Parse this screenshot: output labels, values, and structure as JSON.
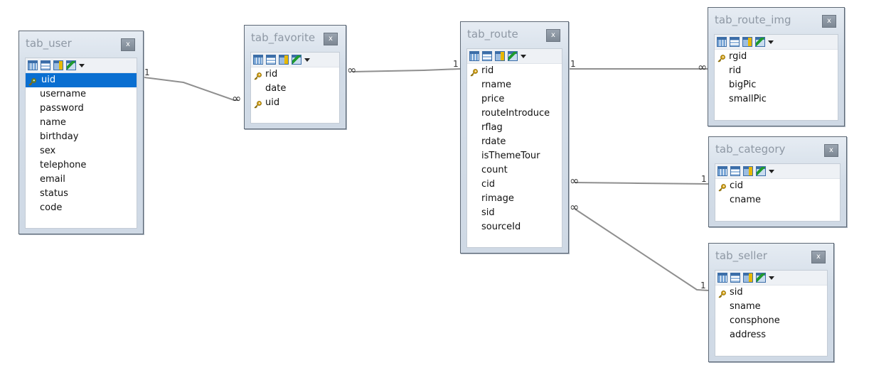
{
  "tables": {
    "tab_user": {
      "title": "tab_user",
      "close_label": "x",
      "fields": [
        {
          "name": "uid",
          "pk": true,
          "selected": true
        },
        {
          "name": "username"
        },
        {
          "name": "password"
        },
        {
          "name": "name"
        },
        {
          "name": "birthday"
        },
        {
          "name": "sex"
        },
        {
          "name": "telephone"
        },
        {
          "name": "email"
        },
        {
          "name": "status"
        },
        {
          "name": "code"
        }
      ]
    },
    "tab_favorite": {
      "title": "tab_favorite",
      "close_label": "x",
      "fields": [
        {
          "name": "rid",
          "pk": true
        },
        {
          "name": "date"
        },
        {
          "name": "uid",
          "pk": true
        }
      ]
    },
    "tab_route": {
      "title": "tab_route",
      "close_label": "x",
      "fields": [
        {
          "name": "rid",
          "pk": true
        },
        {
          "name": "rname"
        },
        {
          "name": "price"
        },
        {
          "name": "routeIntroduce"
        },
        {
          "name": "rflag"
        },
        {
          "name": "rdate"
        },
        {
          "name": "isThemeTour"
        },
        {
          "name": "count"
        },
        {
          "name": "cid"
        },
        {
          "name": "rimage"
        },
        {
          "name": "sid"
        },
        {
          "name": "sourceId"
        }
      ]
    },
    "tab_route_img": {
      "title": "tab_route_img",
      "close_label": "x",
      "fields": [
        {
          "name": "rgid",
          "pk": true
        },
        {
          "name": "rid"
        },
        {
          "name": "bigPic"
        },
        {
          "name": "smallPic"
        }
      ]
    },
    "tab_category": {
      "title": "tab_category",
      "close_label": "x",
      "fields": [
        {
          "name": "cid",
          "pk": true
        },
        {
          "name": "cname"
        }
      ]
    },
    "tab_seller": {
      "title": "tab_seller",
      "close_label": "x",
      "fields": [
        {
          "name": "sid",
          "pk": true
        },
        {
          "name": "sname"
        },
        {
          "name": "consphone"
        },
        {
          "name": "address"
        }
      ]
    }
  },
  "relations": [
    {
      "from": "tab_user",
      "to": "tab_favorite",
      "one_label": "1",
      "many_label": "∞"
    },
    {
      "from": "tab_route",
      "to": "tab_favorite",
      "one_label": "1",
      "many_label": "∞"
    },
    {
      "from": "tab_route",
      "to": "tab_route_img",
      "one_label": "1",
      "many_label": "∞"
    },
    {
      "from": "tab_category",
      "to": "tab_route",
      "one_label": "1",
      "many_label": "∞"
    },
    {
      "from": "tab_seller",
      "to": "tab_route",
      "one_label": "1",
      "many_label": "∞"
    }
  ],
  "colors": {
    "line": "#8f8f8f",
    "selection": "#0a6fd1",
    "key_gold": "#d4a017",
    "key_green": "#5c8a3a"
  }
}
